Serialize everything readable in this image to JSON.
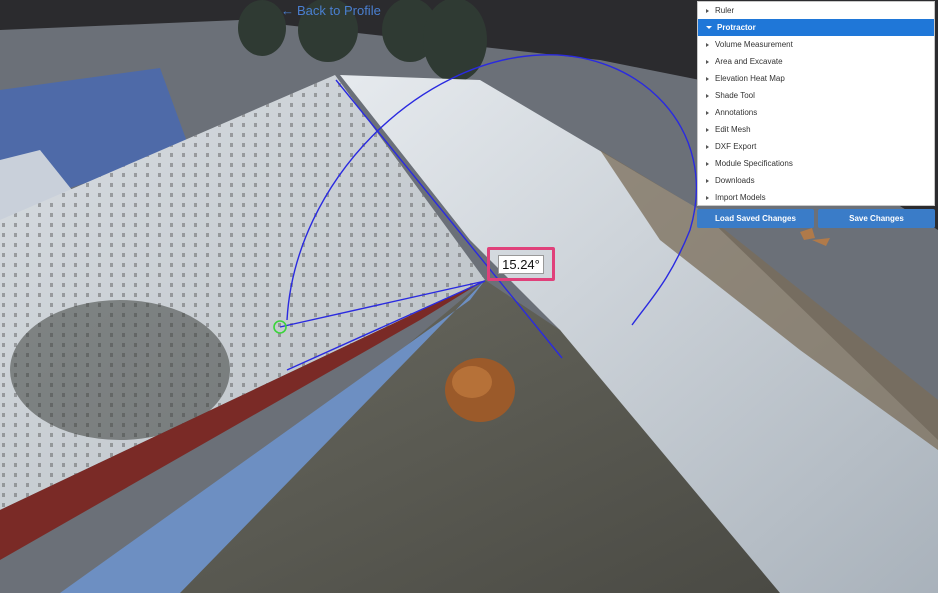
{
  "header": {
    "back_label": "Back to Profile"
  },
  "measurement": {
    "angle": "15.24°",
    "tool": "protractor"
  },
  "tools_panel": {
    "items": [
      {
        "label": "Ruler",
        "active": false
      },
      {
        "label": "Protractor",
        "active": true
      },
      {
        "label": "Volume Measurement",
        "active": false
      },
      {
        "label": "Area and Excavate",
        "active": false
      },
      {
        "label": "Elevation Heat Map",
        "active": false
      },
      {
        "label": "Shade Tool",
        "active": false
      },
      {
        "label": "Annotations",
        "active": false
      },
      {
        "label": "Edit Mesh",
        "active": false
      },
      {
        "label": "DXF Export",
        "active": false
      },
      {
        "label": "Module Specifications",
        "active": false
      },
      {
        "label": "Downloads",
        "active": false
      },
      {
        "label": "Import Models",
        "active": false
      }
    ]
  },
  "actions": {
    "load_label": "Load Saved Changes",
    "save_label": "Save Changes"
  },
  "colors": {
    "accent": "#1f77d8",
    "button": "#3a7cc8",
    "measure_line": "#2a2ae0",
    "highlight": "#e0407a"
  }
}
